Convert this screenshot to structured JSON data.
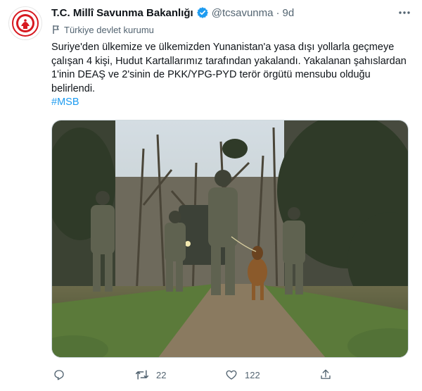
{
  "tweet": {
    "author_name": "T.C. Millî Savunma Bakanlığı",
    "handle": "@tcsavunma",
    "separator": "·",
    "time": "9d",
    "affiliation": "Türkiye devlet kurumu",
    "text": "Suriye'den ülkemize ve ülkemizden Yunanistan'a yasa dışı yollarla geçmeye çalışan 4 kişi, Hudut Kartallarımız tarafından yakalandı. Yakalanan şahıslardan 1'inin DEAŞ ve 2'sinin de PKK/YPG-PYD terör örgütü mensubu olduğu belirlendi.",
    "hashtag": "#MSB",
    "media_alt": "Soldiers and a dog patrolling a dirt path through a forest"
  },
  "actions": {
    "reply_count": "",
    "retweet_count": "22",
    "like_count": "122",
    "share_count": ""
  },
  "icons": {
    "avatar": "ministry-emblem-icon",
    "verified": "verified-badge-icon",
    "more": "more-icon",
    "affiliation": "flag-icon",
    "reply": "reply-icon",
    "retweet": "retweet-icon",
    "like": "heart-icon",
    "share": "share-icon"
  },
  "colors": {
    "brand_red": "#d71920",
    "verified_blue": "#1d9bf0",
    "hashtag_blue": "#1d9bf0",
    "muted_text": "#536471"
  }
}
